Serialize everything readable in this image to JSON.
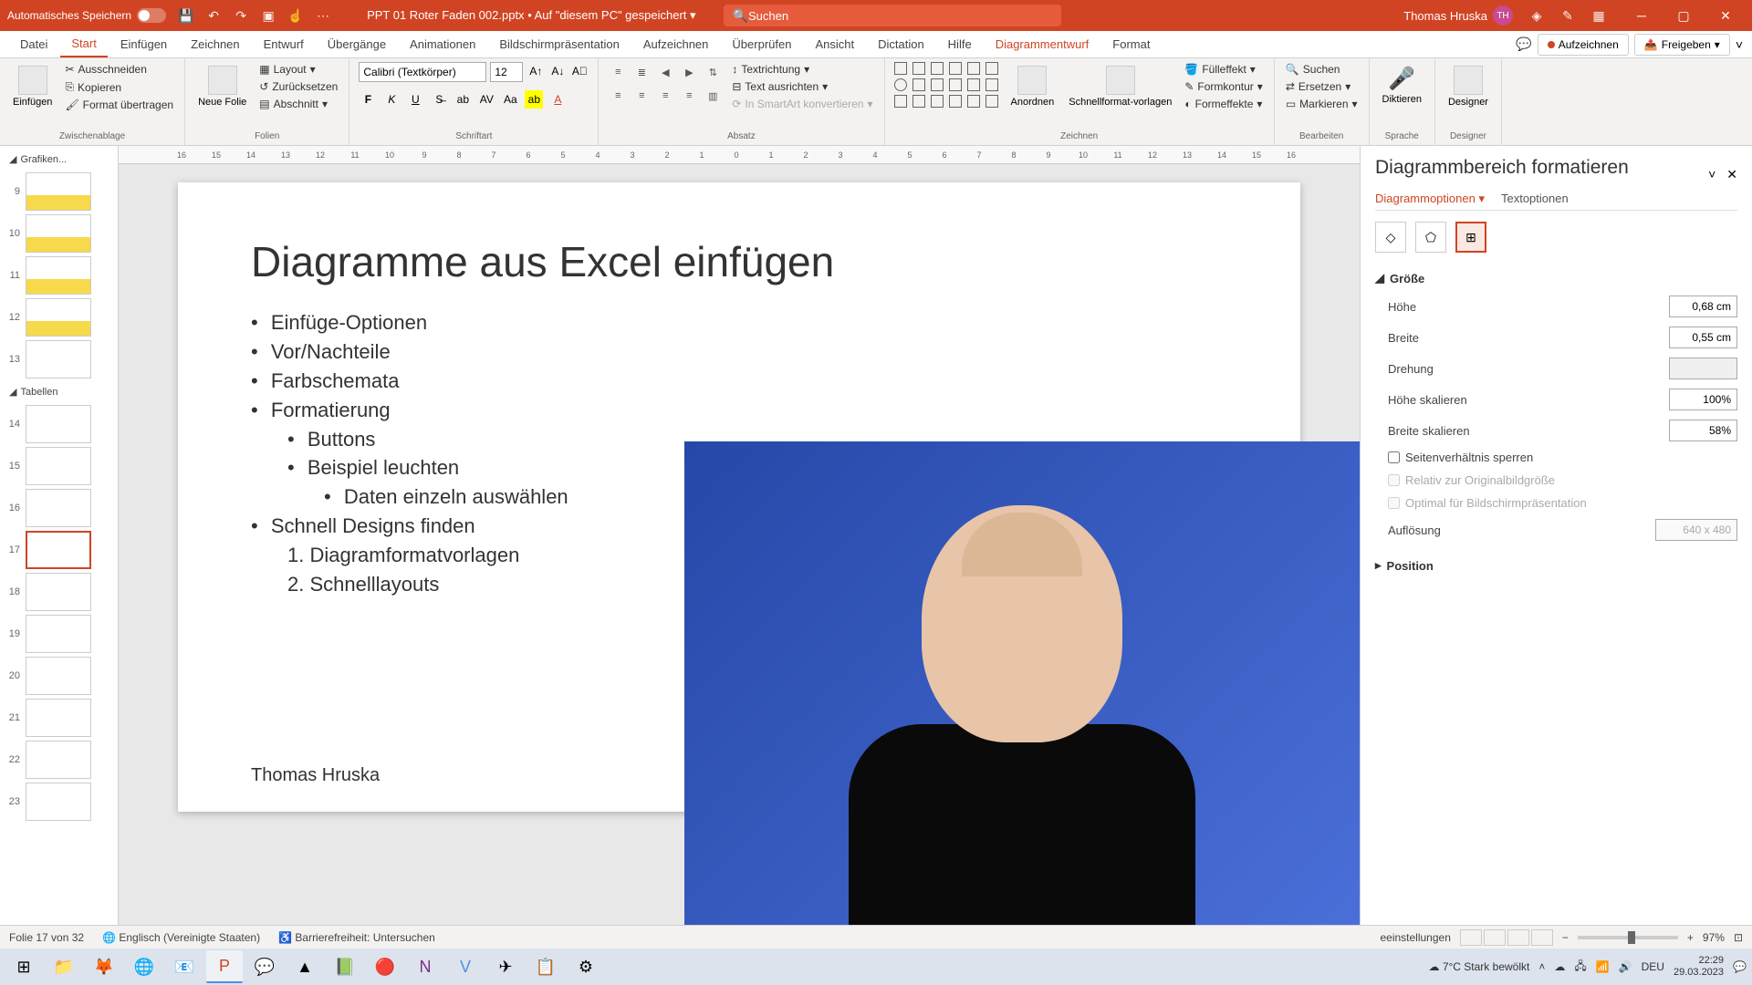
{
  "titlebar": {
    "autosave": "Automatisches Speichern",
    "filename": "PPT 01 Roter Faden 002.pptx",
    "saved_location": "• Auf \"diesem PC\" gespeichert",
    "search_placeholder": "Suchen",
    "user": "Thomas Hruska",
    "user_initials": "TH"
  },
  "menu": {
    "tabs": [
      "Datei",
      "Start",
      "Einfügen",
      "Zeichnen",
      "Entwurf",
      "Übergänge",
      "Animationen",
      "Bildschirmpräsentation",
      "Aufzeichnen",
      "Überprüfen",
      "Ansicht",
      "Dictation",
      "Hilfe",
      "Diagrammentwurf",
      "Format"
    ],
    "active": "Start",
    "record": "Aufzeichnen",
    "share": "Freigeben"
  },
  "ribbon": {
    "paste": "Einfügen",
    "cut": "Ausschneiden",
    "copy": "Kopieren",
    "format_painter": "Format übertragen",
    "group_clipboard": "Zwischenablage",
    "new_slide": "Neue Folie",
    "layout": "Layout",
    "reset": "Zurücksetzen",
    "section": "Abschnitt",
    "group_slides": "Folien",
    "font_name": "Calibri (Textkörper)",
    "font_size": "12",
    "group_font": "Schriftart",
    "group_paragraph": "Absatz",
    "text_direction": "Textrichtung",
    "align_text": "Text ausrichten",
    "smartart": "In SmartArt konvertieren",
    "group_drawing": "Zeichnen",
    "arrange": "Anordnen",
    "quick_styles": "Schnellformat-vorlagen",
    "shape_fill": "Fülleffekt",
    "shape_outline": "Formkontur",
    "shape_effects": "Formeffekte",
    "find": "Suchen",
    "replace": "Ersetzen",
    "select": "Markieren",
    "group_editing": "Bearbeiten",
    "dictate": "Diktieren",
    "group_voice": "Sprache",
    "designer": "Designer",
    "group_designer": "Designer"
  },
  "ruler": [
    "16",
    "15",
    "14",
    "13",
    "12",
    "11",
    "10",
    "9",
    "8",
    "7",
    "6",
    "5",
    "4",
    "3",
    "2",
    "1",
    "0",
    "1",
    "2",
    "3",
    "4",
    "5",
    "6",
    "7",
    "8",
    "9",
    "10",
    "11",
    "12",
    "13",
    "14",
    "15",
    "16"
  ],
  "thumbs": {
    "section1": "Grafiken...",
    "section2": "Tabellen",
    "numbers": [
      "9",
      "10",
      "11",
      "12",
      "13",
      "14",
      "15",
      "16",
      "17",
      "18",
      "19",
      "20",
      "21",
      "22",
      "23"
    ],
    "active": "17"
  },
  "slide": {
    "title": "Diagramme aus Excel einfügen",
    "bullets": [
      {
        "lvl": 1,
        "text": "Einfüge-Optionen"
      },
      {
        "lvl": 1,
        "text": "Vor/Nachteile"
      },
      {
        "lvl": 1,
        "text": "Farbschemata"
      },
      {
        "lvl": 1,
        "text": "Formatierung"
      },
      {
        "lvl": 2,
        "text": "Buttons"
      },
      {
        "lvl": 2,
        "text": "Beispiel leuchten"
      },
      {
        "lvl": 3,
        "text": "Daten einzeln auswählen"
      },
      {
        "lvl": 1,
        "text": "Schnell Designs finden"
      }
    ],
    "numbered": [
      "1.    Diagramformatvorlagen",
      "2.    Schnelllayouts"
    ],
    "author": "Thomas Hruska"
  },
  "format_pane": {
    "title": "Diagrammbereich formatieren",
    "tab_chart": "Diagrammoptionen",
    "tab_text": "Textoptionen",
    "section_size": "Größe",
    "section_position": "Position",
    "height": "Höhe",
    "height_val": "0,68 cm",
    "width": "Breite",
    "width_val": "0,55 cm",
    "rotation": "Drehung",
    "rotation_val": "",
    "scale_h": "Höhe skalieren",
    "scale_h_val": "100%",
    "scale_w": "Breite skalieren",
    "scale_w_val": "58%",
    "lock_aspect": "Seitenverhältnis sperren",
    "relative_orig": "Relativ zur Originalbildgröße",
    "optimal_pres": "Optimal für Bildschirmpräsentation",
    "resolution": "Auflösung",
    "resolution_val": "640 x 480"
  },
  "statusbar": {
    "slide_count": "Folie 17 von 32",
    "language": "Englisch (Vereinigte Staaten)",
    "accessibility": "Barrierefreiheit: Untersuchen",
    "settings": "eeinstellungen",
    "zoom": "97%"
  },
  "taskbar": {
    "weather_temp": "7°C",
    "weather_desc": "Stark bewölkt",
    "lang": "DEU",
    "time": "22:29",
    "date": "29.03.2023"
  }
}
